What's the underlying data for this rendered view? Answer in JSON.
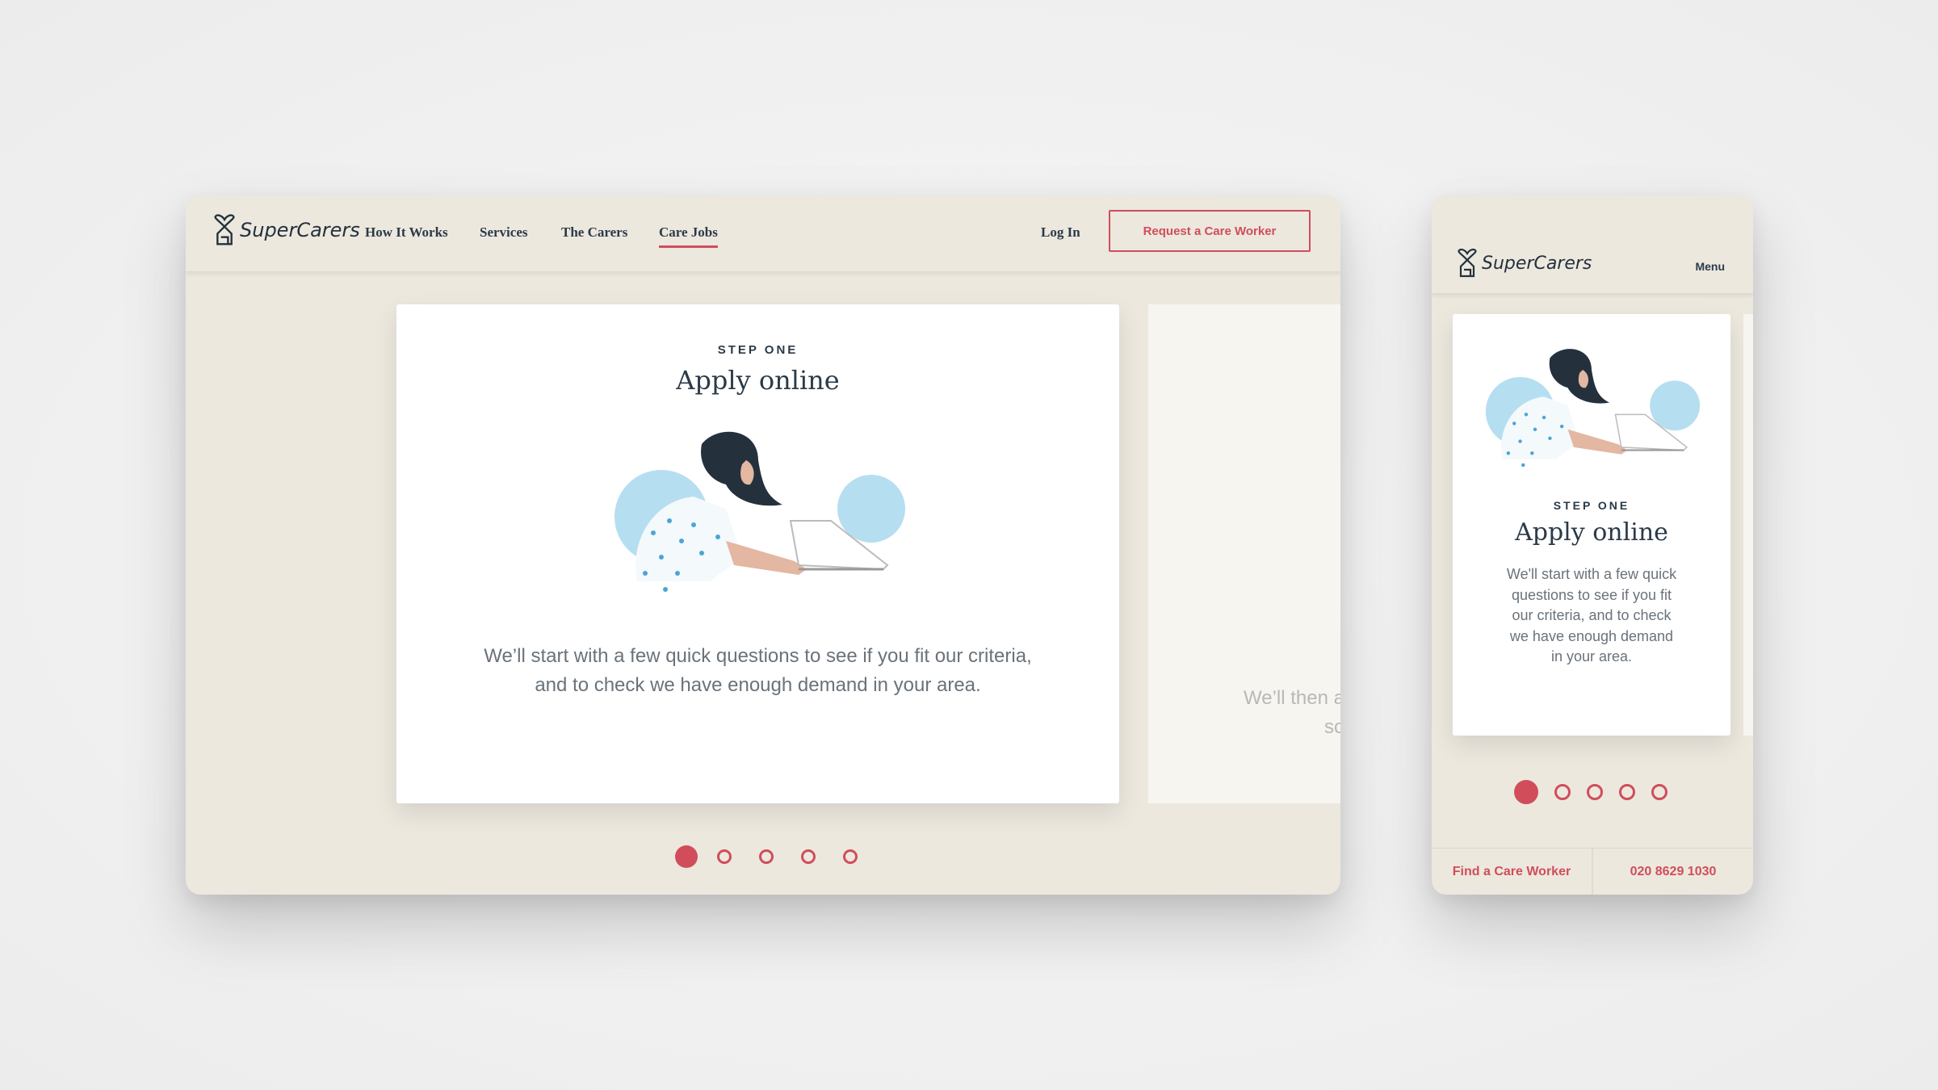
{
  "brand": "SuperCarers",
  "colors": {
    "accent": "#d14d5a",
    "frame": "#ece8de",
    "text": "#2b3a48"
  },
  "desktop": {
    "nav": [
      "How It Works",
      "Services",
      "The Carers",
      "Care Jobs"
    ],
    "active_nav": "Care Jobs",
    "login": "Log In",
    "cta": "Request a Care Worker",
    "card": {
      "step": "STEP ONE",
      "title": "Apply online",
      "body_line1": "We’ll start with a few quick questions to see if you fit our criteria,",
      "body_line2": "and to check we have enough demand in your area."
    },
    "next_card": {
      "line1": "We’ll then a",
      "line2": "sc"
    },
    "carousel": {
      "total": 5,
      "active": 1
    }
  },
  "mobile": {
    "menu": "Menu",
    "card": {
      "step": "STEP ONE",
      "title": "Apply online",
      "body": "We'll start with a few quick questions to see if you fit our criteria, and to check we have enough demand in your area."
    },
    "carousel": {
      "total": 5,
      "active": 1
    },
    "footer": {
      "find": "Find a Care Worker",
      "phone": "020 8629 1030"
    }
  }
}
